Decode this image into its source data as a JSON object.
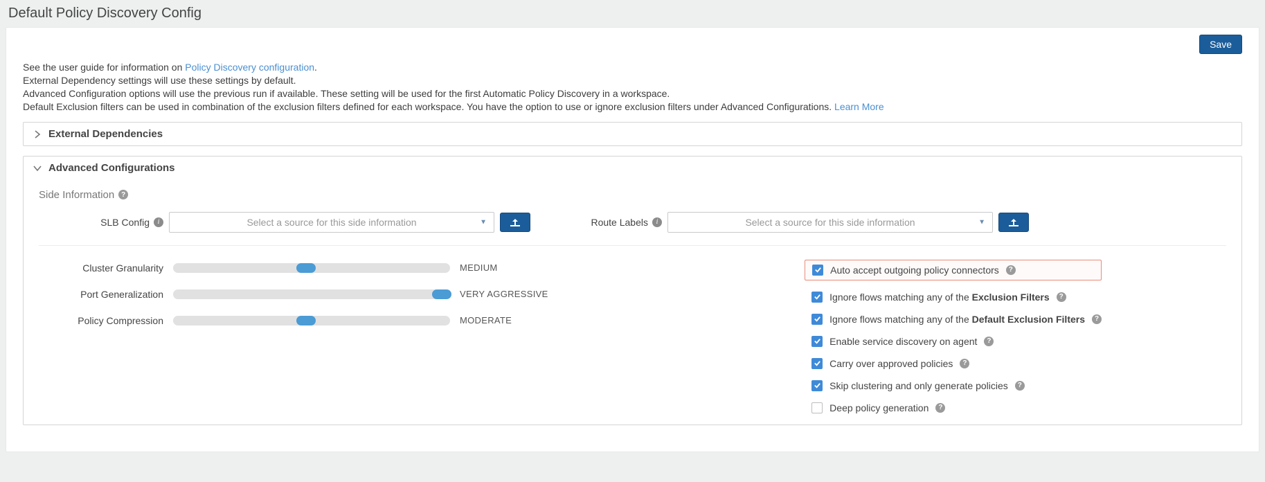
{
  "page": {
    "title": "Default Policy Discovery Config",
    "save_label": "Save"
  },
  "intro": {
    "line1_prefix": "See the user guide for information on ",
    "line1_link": "Policy Discovery configuration",
    "line1_suffix": ".",
    "line2": "External Dependency settings will use these settings by default.",
    "line3": "Advanced Configuration options will use the previous run if available. These setting will be used for the first Automatic Policy Discovery in a workspace.",
    "line4_prefix": "Default Exclusion filters can be used in combination of the exclusion filters defined for each workspace. You have the option to use or ignore exclusion filters under Advanced Configurations. ",
    "line4_link": "Learn More"
  },
  "accordions": {
    "external_deps": {
      "title": "External Dependencies",
      "expanded": false
    },
    "advanced": {
      "title": "Advanced Configurations",
      "expanded": true
    }
  },
  "advanced": {
    "side_info_title": "Side Information",
    "slb": {
      "label": "SLB Config",
      "placeholder": "Select a source for this side information"
    },
    "route_labels": {
      "label": "Route Labels",
      "placeholder": "Select a source for this side information"
    },
    "sliders": [
      {
        "label": "Cluster Granularity",
        "value_text": "Medium",
        "thumb_pct": 48
      },
      {
        "label": "Port Generalization",
        "value_text": "Very Aggressive",
        "thumb_pct": 97
      },
      {
        "label": "Policy Compression",
        "value_text": "Moderate",
        "thumb_pct": 48
      }
    ],
    "checks": [
      {
        "checked": true,
        "highlight": true,
        "text": "Auto accept outgoing policy connectors"
      },
      {
        "checked": true,
        "highlight": false,
        "text_prefix": "Ignore flows matching any of the ",
        "text_bold": "Exclusion Filters"
      },
      {
        "checked": true,
        "highlight": false,
        "text_prefix": "Ignore flows matching any of the ",
        "text_bold": "Default Exclusion Filters"
      },
      {
        "checked": true,
        "highlight": false,
        "text": "Enable service discovery on agent"
      },
      {
        "checked": true,
        "highlight": false,
        "text": "Carry over approved policies"
      },
      {
        "checked": true,
        "highlight": false,
        "text": "Skip clustering and only generate policies"
      },
      {
        "checked": false,
        "highlight": false,
        "text": "Deep policy generation"
      }
    ]
  }
}
